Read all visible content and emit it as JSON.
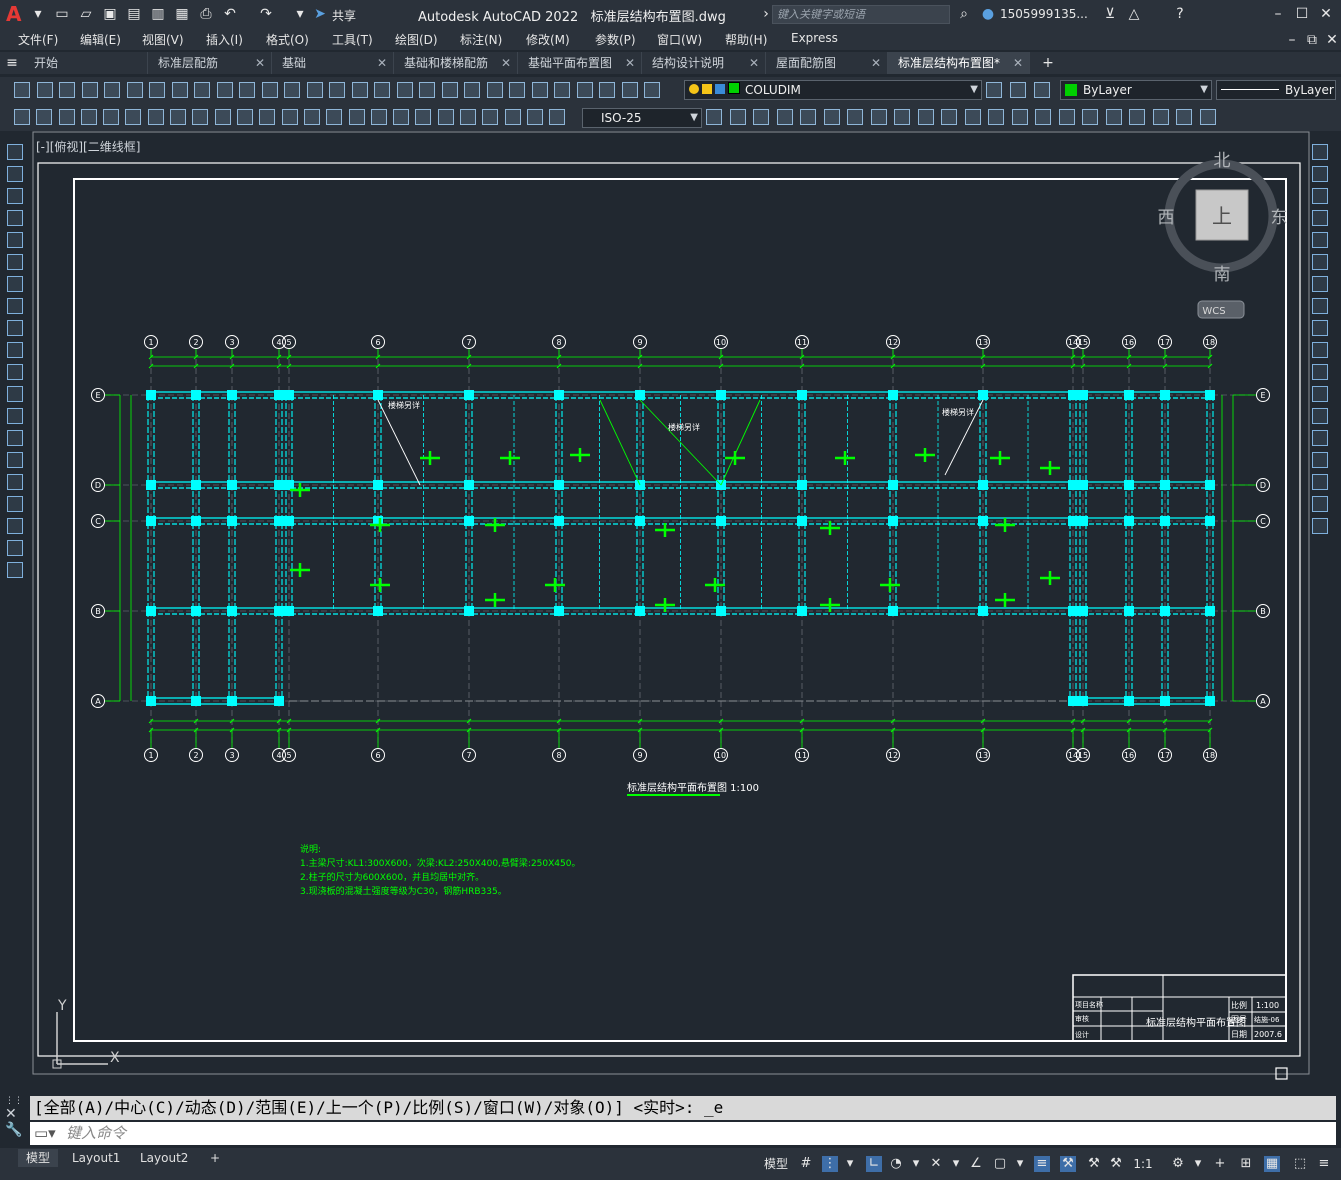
{
  "app": {
    "name": "Autodesk AutoCAD 2022",
    "file": "标准层结构布置图.dwg",
    "search_placeholder": "键入关键字或短语",
    "user": "1505999135...",
    "share": "共享"
  },
  "menus": [
    "文件(F)",
    "编辑(E)",
    "视图(V)",
    "插入(I)",
    "格式(O)",
    "工具(T)",
    "绘图(D)",
    "标注(N)",
    "修改(M)",
    "参数(P)",
    "窗口(W)",
    "帮助(H)",
    "Express"
  ],
  "tabs": [
    {
      "label": "开始",
      "closable": false
    },
    {
      "label": "标准层配筋",
      "closable": true
    },
    {
      "label": "基础",
      "closable": true
    },
    {
      "label": "基础和楼梯配筋",
      "closable": true
    },
    {
      "label": "基础平面布置图",
      "closable": true
    },
    {
      "label": "结构设计说明",
      "closable": true
    },
    {
      "label": "屋面配筋图",
      "closable": true
    },
    {
      "label": "标准层结构布置图*",
      "closable": true,
      "active": true
    }
  ],
  "layer": {
    "name": "COLUDIM",
    "color": "#00d000"
  },
  "color_combo": "ByLayer",
  "linetype_combo": "ByLayer",
  "dimstyle_combo": "ISO-25",
  "viewport_label": "[-][俯视][二维线框]",
  "viewcube": {
    "north": "北",
    "south": "南",
    "east": "东",
    "west": "西",
    "face": "上",
    "wcs": "WCS"
  },
  "ucs": {
    "x": "X",
    "y": "Y"
  },
  "drawing": {
    "axes_x": [
      "1",
      "2",
      "3",
      "4",
      "5",
      "6",
      "7",
      "8",
      "9",
      "10",
      "11",
      "12",
      "13",
      "14",
      "15",
      "16",
      "17",
      "18"
    ],
    "axes_y": [
      "E",
      "D",
      "C",
      "B",
      "A"
    ],
    "title": "标准层结构平面布置图 1:100",
    "notes_title": "说明:",
    "notes": [
      "1.主梁尺寸:KL1:300X600，次梁:KL2:250X400,悬臂梁:250X450。",
      "2.柱子的尺寸为600X600，并且均居中对齐。",
      "3.现浇板的混凝土强度等级为C30，钢筋HRB335。"
    ],
    "stair_label": "楼梯另详",
    "titleblock": {
      "name": "标准层结构平面布置图",
      "rows": [
        "项目名称",
        "审核",
        "设计"
      ],
      "scale_label": "比例",
      "scale": "1:100",
      "no_label": "图号",
      "no": "结施-06",
      "date_label": "日期",
      "date": "2007.6"
    }
  },
  "command": {
    "history": "[全部(A)/中心(C)/动态(D)/范围(E)/上一个(P)/比例(S)/窗口(W)/对象(O)] <实时>: _e",
    "placeholder": "键入命令"
  },
  "layouts": [
    {
      "label": "模型",
      "active": true
    },
    {
      "label": "Layout1"
    },
    {
      "label": "Layout2"
    }
  ],
  "status": {
    "model": "模型",
    "scale": "1:1"
  },
  "colors": {
    "accent": "#00ffff",
    "line": "#00ff00",
    "bg": "#212830"
  }
}
